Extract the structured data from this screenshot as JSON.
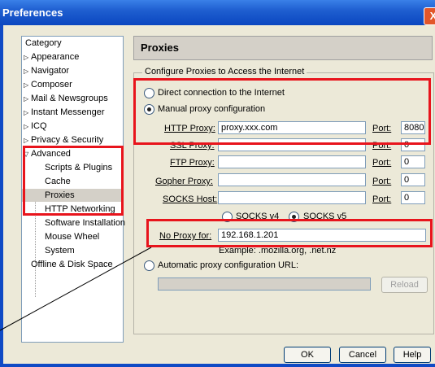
{
  "window": {
    "title": "Preferences",
    "close_glyph": "X"
  },
  "category": {
    "header": "Category",
    "items": [
      {
        "label": "Appearance",
        "expander": "▷"
      },
      {
        "label": "Navigator",
        "expander": "▷"
      },
      {
        "label": "Composer",
        "expander": "▷"
      },
      {
        "label": "Mail & Newsgroups",
        "expander": "▷"
      },
      {
        "label": "Instant Messenger",
        "expander": "▷"
      },
      {
        "label": "ICQ",
        "expander": "▷"
      },
      {
        "label": "Privacy & Security",
        "expander": "▷"
      },
      {
        "label": "Advanced",
        "expander": "▽"
      },
      {
        "label": "Scripts & Plugins"
      },
      {
        "label": "Cache"
      },
      {
        "label": "Proxies",
        "selected": true
      },
      {
        "label": "HTTP Networking"
      },
      {
        "label": "Software Installation"
      },
      {
        "label": "Mouse Wheel"
      },
      {
        "label": "System"
      },
      {
        "label": "Offline & Disk Space"
      }
    ]
  },
  "panel": {
    "title": "Proxies",
    "group_label": "Configure Proxies to Access the Internet",
    "direct_label": "Direct connection to the Internet",
    "manual_label": "Manual proxy configuration",
    "rows": [
      {
        "label": "HTTP Proxy:",
        "value": "proxy.xxx.com",
        "port_label": "Port:",
        "port": "8080"
      },
      {
        "label": "SSL Proxy:",
        "value": "",
        "port_label": "Port:",
        "port": "0"
      },
      {
        "label": "FTP Proxy:",
        "value": "",
        "port_label": "Port:",
        "port": "0"
      },
      {
        "label": "Gopher Proxy:",
        "value": "",
        "port_label": "Port:",
        "port": "0"
      },
      {
        "label": "SOCKS Host:",
        "value": "",
        "port_label": "Port:",
        "port": "0"
      }
    ],
    "socks_v4": "SOCKS v4",
    "socks_v5": "SOCKS v5",
    "no_proxy_label": "No Proxy for:",
    "no_proxy_value": "192.168.1.201",
    "example": "Example: .mozilla.org, .net.nz",
    "auto_label": "Automatic proxy configuration URL:",
    "auto_url": "",
    "reload": "Reload"
  },
  "buttons": {
    "ok": "OK",
    "cancel": "Cancel",
    "help": "Help"
  },
  "colors": {
    "highlight": "#e8141c",
    "titlebar": "#0a46c0"
  }
}
